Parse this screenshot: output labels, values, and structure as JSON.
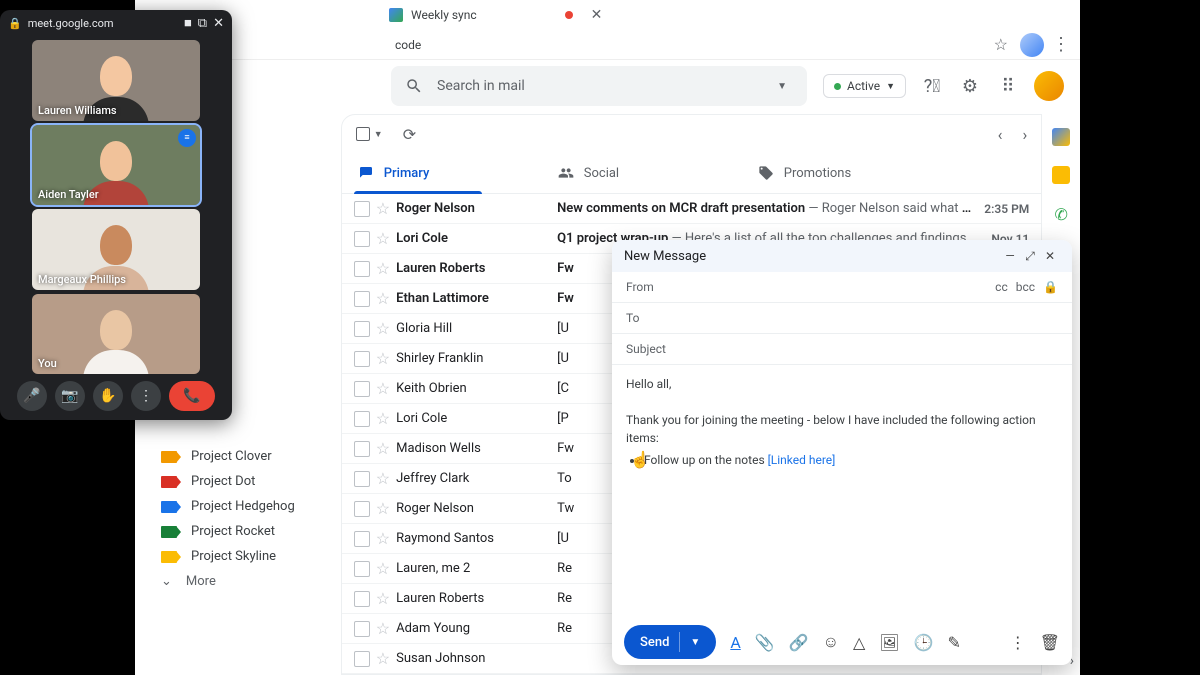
{
  "browser": {
    "tab_title": "Weekly sync",
    "addr_suffix": "code"
  },
  "meet": {
    "url": "meet.google.com",
    "participants": [
      {
        "name": "Lauren Williams",
        "skin": "#f4c7a1",
        "shirt": "#2b2b2b",
        "bg": "#8d837a"
      },
      {
        "name": "Aiden Tayler",
        "skin": "#f1c29a",
        "shirt": "#b2443a",
        "bg": "#6e7d60",
        "speaking": true
      },
      {
        "name": "Margeaux Phillips",
        "skin": "#c98a5e",
        "shirt": "#d8b49a",
        "bg": "#e8e4dd"
      },
      {
        "name": "You",
        "skin": "#e9c6a4",
        "shirt": "#f5f2ee",
        "bg": "#b79c88"
      }
    ]
  },
  "search": {
    "placeholder": "Search in mail"
  },
  "header": {
    "active_label": "Active"
  },
  "tabs": {
    "primary": "Primary",
    "social": "Social",
    "promotions": "Promotions"
  },
  "sidebar": {
    "labels": [
      {
        "name": "Project Clover",
        "color": "t-orange"
      },
      {
        "name": "Project Dot",
        "color": "t-red"
      },
      {
        "name": "Project Hedgehog",
        "color": "t-blue"
      },
      {
        "name": "Project Rocket",
        "color": "t-green"
      },
      {
        "name": "Project Skyline",
        "color": "t-yellow"
      }
    ],
    "more": "More"
  },
  "emails": [
    {
      "sender": "Roger Nelson",
      "subject": "New comments on MCR draft presentation",
      "snippet": " — Roger Nelson said what abou…",
      "time": "2:35 PM",
      "bold": true
    },
    {
      "sender": "Lori Cole",
      "subject": "Q1 project wrap-up",
      "snippet": " — Here's a list of all the top challenges and findings. Su…",
      "time": "Nov 11",
      "bold": true
    },
    {
      "sender": "Lauren Roberts",
      "subject": "Fw",
      "snippet": "",
      "time": "",
      "bold": true
    },
    {
      "sender": "Ethan Lattimore",
      "subject": "Fw",
      "snippet": "",
      "time": "",
      "bold": true
    },
    {
      "sender": "Gloria Hill",
      "subject": "[U",
      "snippet": "",
      "time": "",
      "bold": false
    },
    {
      "sender": "Shirley Franklin",
      "subject": "[U",
      "snippet": "",
      "time": "",
      "bold": false
    },
    {
      "sender": "Keith Obrien",
      "subject": "[C",
      "snippet": "",
      "time": "",
      "bold": false
    },
    {
      "sender": "Lori Cole",
      "subject": "[P",
      "snippet": "",
      "time": "",
      "bold": false
    },
    {
      "sender": "Madison Wells",
      "subject": "Fw",
      "snippet": "",
      "time": "",
      "bold": false
    },
    {
      "sender": "Jeffrey Clark",
      "subject": "To",
      "snippet": "",
      "time": "",
      "bold": false
    },
    {
      "sender": "Roger Nelson",
      "subject": "Tw",
      "snippet": "",
      "time": "",
      "bold": false
    },
    {
      "sender": "Raymond Santos",
      "subject": "[U",
      "snippet": "",
      "time": "",
      "bold": false
    },
    {
      "sender": "Lauren, me  2",
      "subject": "Re",
      "snippet": "",
      "time": "",
      "bold": false
    },
    {
      "sender": "Lauren Roberts",
      "subject": "Re",
      "snippet": "",
      "time": "",
      "bold": false
    },
    {
      "sender": "Adam Young",
      "subject": "Re",
      "snippet": "",
      "time": "",
      "bold": false
    },
    {
      "sender": "Susan Johnson",
      "subject": "",
      "snippet": "",
      "time": "",
      "bold": false
    }
  ],
  "compose": {
    "title": "New Message",
    "from": "From",
    "to": "To",
    "subject": "Subject",
    "cc": "cc",
    "bcc": "bcc",
    "greeting": "Hello all,",
    "line": "Thank you for joining the meeting - below I have included the following action items:",
    "bullet": "Follow up on the notes ",
    "link": "[Linked here]",
    "send": "Send"
  }
}
